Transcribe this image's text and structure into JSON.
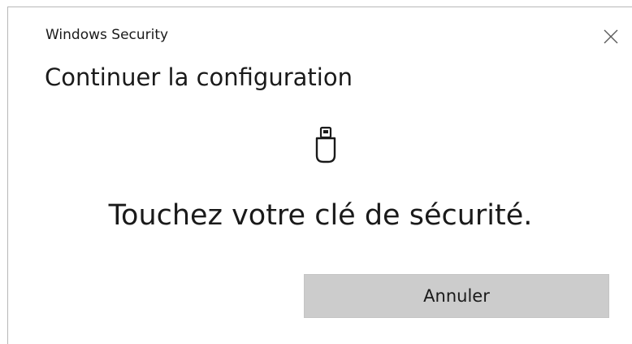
{
  "window": {
    "app_title": "Windows Security",
    "close_icon": "close-icon"
  },
  "dialog": {
    "heading": "Continuer la configuration",
    "icon": "usb-security-key-icon",
    "message": "Touchez votre clé de sécurité.",
    "cancel_label": "Annuler"
  },
  "colors": {
    "background": "#ffffff",
    "button_background": "#cccccc",
    "text": "#1a1a1a"
  }
}
